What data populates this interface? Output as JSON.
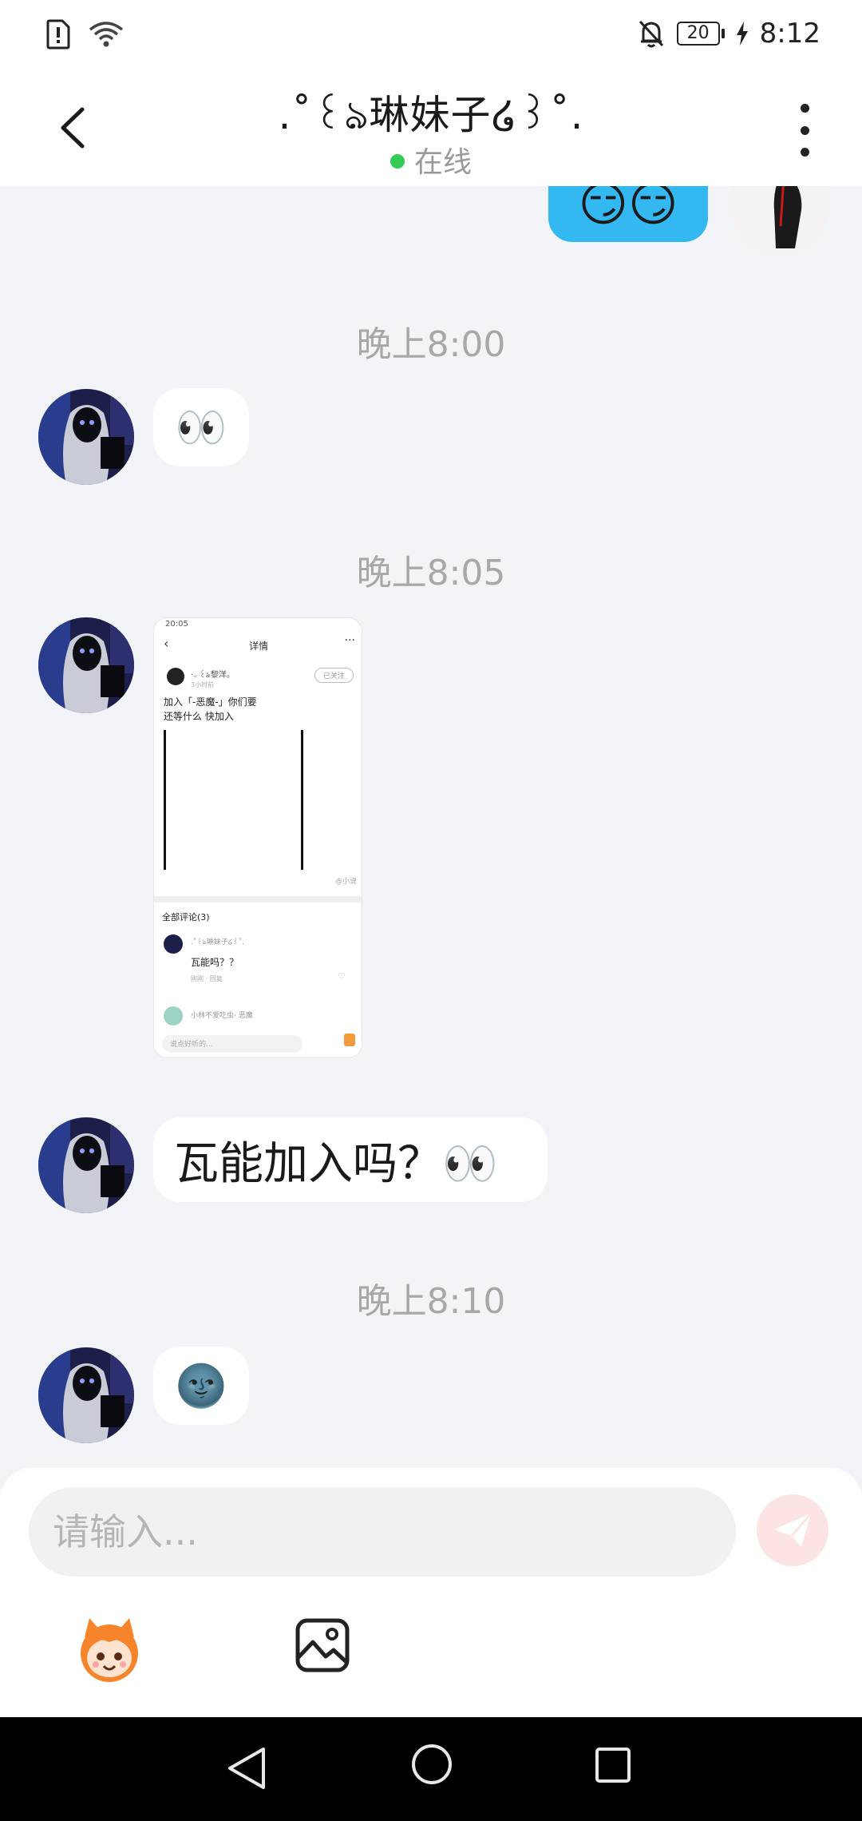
{
  "status_bar": {
    "time": "8:12",
    "battery": "20"
  },
  "header": {
    "title": ".˚꒰ঌ琳妹子໒꒱˚.",
    "status": "在线"
  },
  "messages": {
    "top_partial_emoji": "😏😏",
    "time_1": "晚上8:00",
    "msg_1": "👀",
    "time_2": "晚上8:05",
    "time_3_hidden": "",
    "msg_3": "瓦能加入吗？👀",
    "time_4": "晚上8:10",
    "msg_4": "🌚"
  },
  "screenshot_preview": {
    "time": "20:05",
    "title": "详情",
    "follow_label": "已关注",
    "username": "·。꒰ঌ黎洋。",
    "sub": "3小时前",
    "post_line_1": "加入「-恶魔-」你们要",
    "post_line_2": "还等什么 快加入",
    "watermark": "@小说",
    "comments_header": "全部评论(3)",
    "comment_user": ".˚꒰ঌ琳妹子໒꒱˚.",
    "comment_text": "瓦能吗？？",
    "comment_meta": "刚刚 · 回复",
    "comment2_user": "小林不爱吃虫· 恶魔",
    "reply_placeholder": "说点好听的..."
  },
  "composer": {
    "input_placeholder": "请输入..."
  },
  "colors": {
    "accent_bubble": "#33b8f2",
    "send_button_bg": "#fde4e4",
    "online_dot": "#33cc55"
  }
}
